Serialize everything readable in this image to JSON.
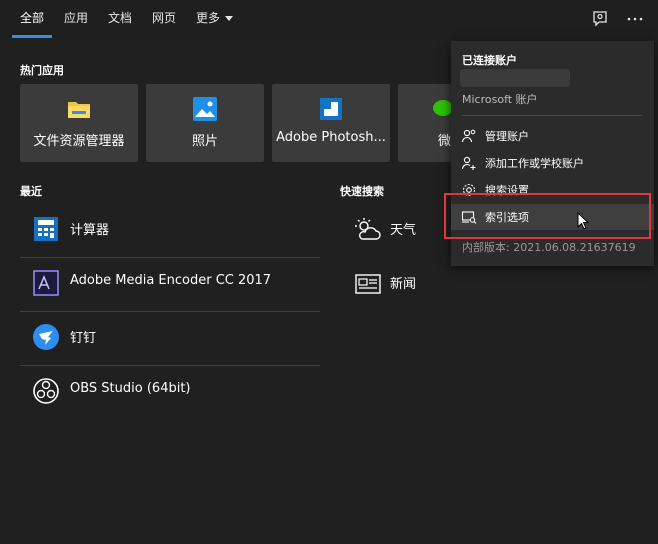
{
  "tabs": [
    {
      "label": "全部",
      "active": true
    },
    {
      "label": "应用"
    },
    {
      "label": "文档"
    },
    {
      "label": "网页"
    },
    {
      "label": "更多"
    }
  ],
  "top_right_icons": [
    "feedback-icon",
    "more-options-icon"
  ],
  "pinned": {
    "title": "热门应用",
    "apps": [
      {
        "label": "文件资源管理器",
        "icon": "file-explorer-icon"
      },
      {
        "label": "照片",
        "icon": "photos-icon"
      },
      {
        "label": "Adobe Photosh...",
        "icon": "photoshop-icon"
      },
      {
        "label": "微",
        "icon": "wechat-icon"
      }
    ]
  },
  "recent": {
    "title": "最近",
    "items": [
      {
        "label": "计算器",
        "icon": "calculator-icon"
      },
      {
        "label": "Adobe Media Encoder CC 2017",
        "icon": "media-encoder-icon"
      },
      {
        "label": "钉钉",
        "icon": "dingtalk-icon"
      },
      {
        "label": "OBS Studio (64bit)",
        "icon": "obs-icon"
      }
    ]
  },
  "quick_search": {
    "title": "快速搜索",
    "items": [
      {
        "label": "天气",
        "icon": "weather-icon"
      },
      {
        "label": "新闻",
        "icon": "news-icon"
      }
    ]
  },
  "account_menu": {
    "title": "已连接账户",
    "account_type": "Microsoft 账户",
    "items": [
      {
        "label": "管理账户",
        "icon": "manage-accounts-icon"
      },
      {
        "label": "添加工作或学校账户",
        "icon": "add-account-icon"
      },
      {
        "label": "搜索设置",
        "icon": "gear-icon"
      },
      {
        "label": "索引选项",
        "icon": "indexing-options-icon",
        "hovered": true
      }
    ],
    "version": "内部版本: 2021.06.08.21637619"
  },
  "colors": {
    "accent": "#3a8ee6",
    "highlight": "#e0383e",
    "background": "#202020"
  }
}
